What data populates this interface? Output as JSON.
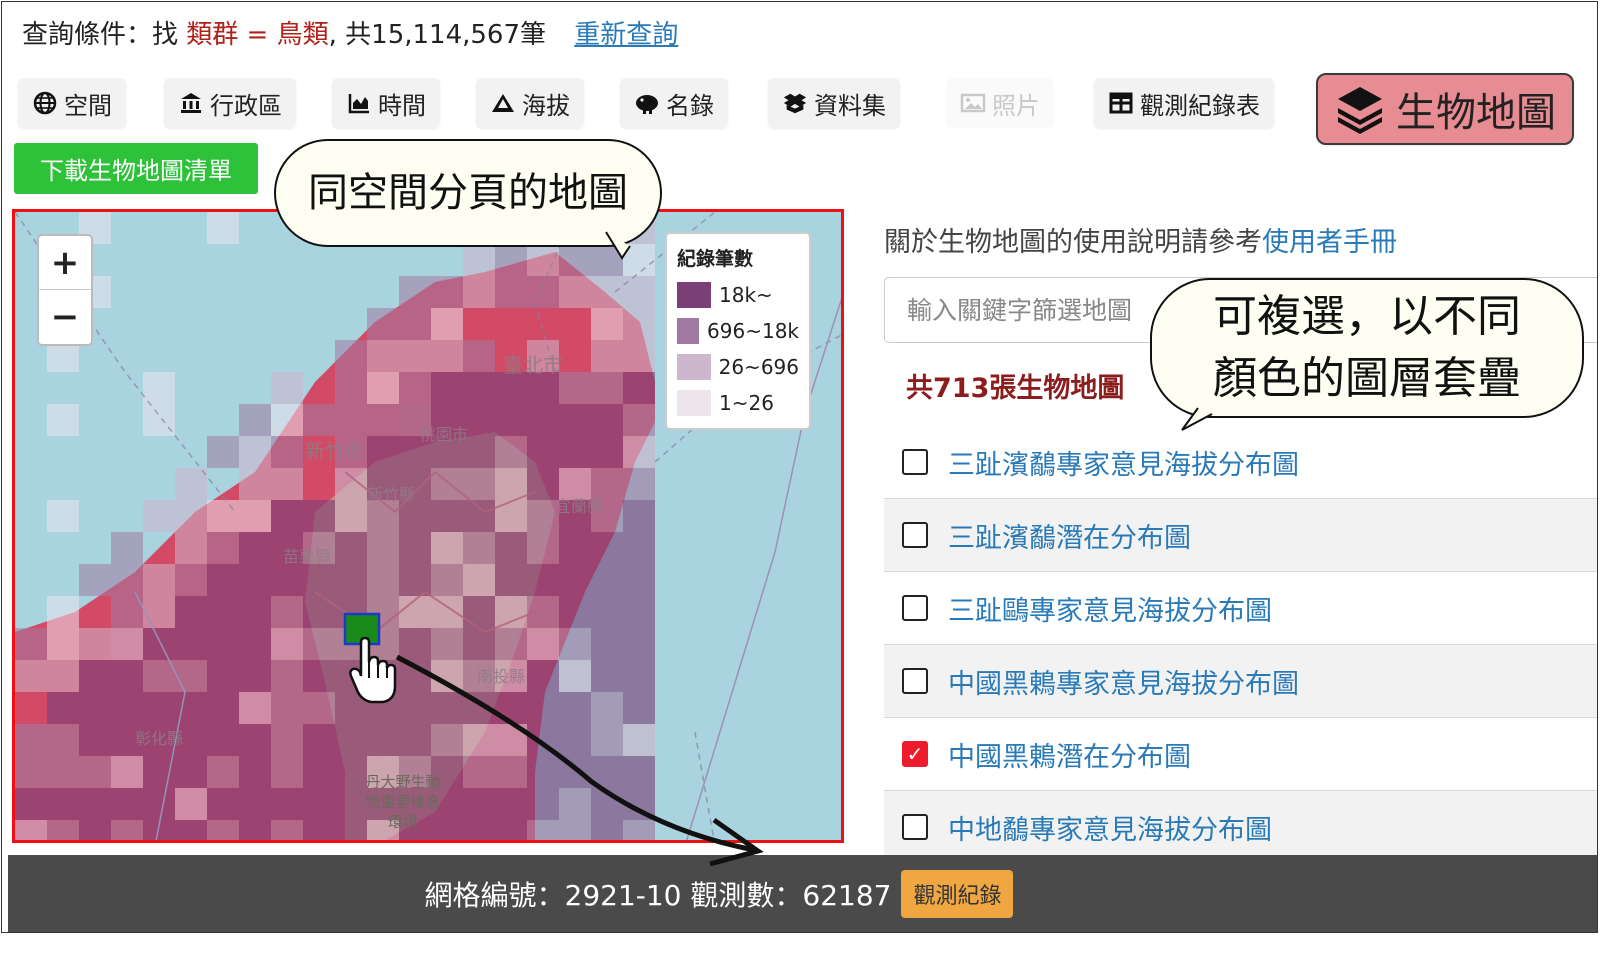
{
  "query": {
    "prefix": "查詢條件：找 ",
    "field": "類群",
    "op": " = ",
    "value": "鳥類",
    "suffix": ", 共15,114,567筆",
    "requery_label": "重新查詢"
  },
  "tabs": [
    {
      "label": "空間",
      "icon": "globe-icon"
    },
    {
      "label": "行政區",
      "icon": "government-building-icon"
    },
    {
      "label": "時間",
      "icon": "area-chart-icon"
    },
    {
      "label": "海拔",
      "icon": "mountain-icon"
    },
    {
      "label": "名錄",
      "icon": "bird-icon"
    },
    {
      "label": "資料集",
      "icon": "boxes-icon"
    },
    {
      "label": "照片",
      "icon": "image-icon"
    },
    {
      "label": "觀測紀錄表",
      "icon": "table-icon"
    },
    {
      "label": "生物地圖",
      "icon": "layers-icon"
    }
  ],
  "download_label": "下載生物地圖清單",
  "map": {
    "zoom_in": "+",
    "zoom_out": "−",
    "legend_title": "紀錄筆數",
    "legend": [
      {
        "label": "18k~",
        "color": "#7b3f78"
      },
      {
        "label": "696~18k",
        "color": "#a07aa0"
      },
      {
        "label": "26~696",
        "color": "#cdb7cc"
      },
      {
        "label": "1~26",
        "color": "#ede4ec"
      }
    ],
    "place_labels": [
      "臺北市",
      "新竹市",
      "新竹縣",
      "桃園市",
      "苗栗縣",
      "宜蘭縣",
      "彰化縣",
      "南投縣",
      "丹大野生動物重要棲息環境"
    ],
    "selected_cell_color": "#1a8a1a"
  },
  "callouts": {
    "map": "同空間分頁的地圖",
    "multi_line1": "可複選，以不同",
    "multi_line2": "顏色的圖層套疊"
  },
  "help": {
    "text": "關於生物地圖的使用說明請參考",
    "link": "使用者手冊"
  },
  "search_placeholder": "輸入關鍵字篩選地圖",
  "map_count": "共713張生物地圖",
  "maps": [
    {
      "label": "三趾濱鷸專家意見海拔分布圖",
      "checked": false
    },
    {
      "label": "三趾濱鷸潛在分布圖",
      "checked": false
    },
    {
      "label": "三趾鷗專家意見海拔分布圖",
      "checked": false
    },
    {
      "label": "中國黑鶇專家意見海拔分布圖",
      "checked": false
    },
    {
      "label": "中國黑鶇潛在分布圖",
      "checked": true
    },
    {
      "label": "中地鷸專家意見海拔分布圖",
      "checked": false
    }
  ],
  "status": {
    "text": "網格編號：2921-10 觀測數：62187",
    "button": "觀測紀錄"
  }
}
